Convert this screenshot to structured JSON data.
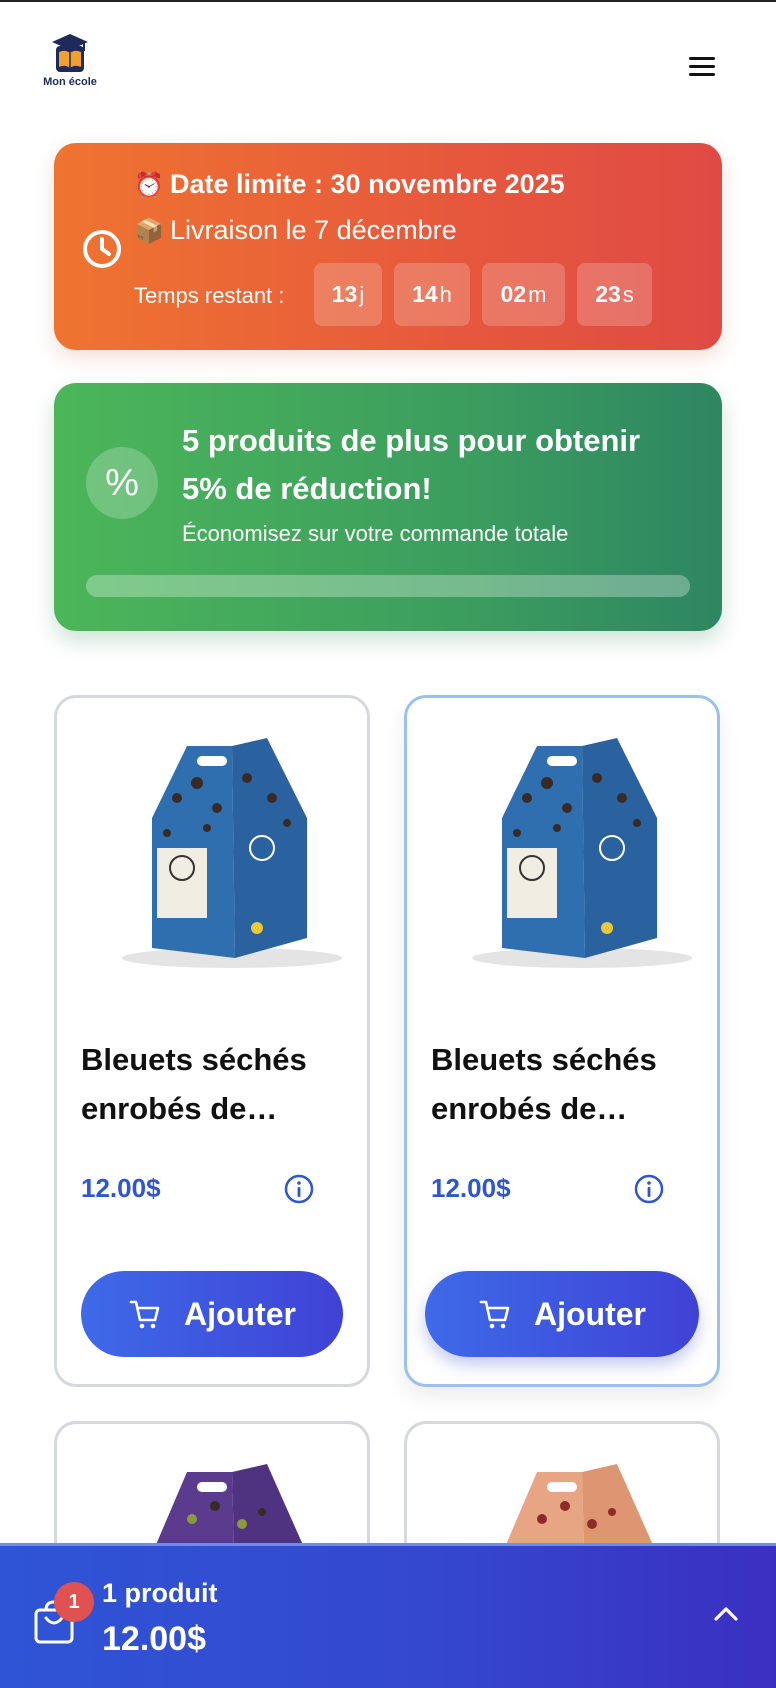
{
  "header": {
    "logo_text": "Mon école",
    "logo_icon": "school-book-icon",
    "menu_icon": "hamburger-menu-icon"
  },
  "deadline": {
    "title_emoji": "⏰",
    "title": "Date limite : 30 novembre 2025",
    "delivery_emoji": "📦",
    "delivery": "Livraison le 7 décembre",
    "remaining_label": "Temps restant :",
    "countdown": [
      {
        "value": "13",
        "unit": "j"
      },
      {
        "value": "14",
        "unit": "h"
      },
      {
        "value": "02",
        "unit": "m"
      },
      {
        "value": "23",
        "unit": "s"
      }
    ],
    "icon": "clock-icon"
  },
  "discount": {
    "symbol": "%",
    "title": "5 produits de plus pour obtenir 5% de réduction!",
    "subtitle": "Économisez sur votre commande totale",
    "progress": 0
  },
  "products": [
    {
      "name": "Bleuets séchés enrobés de…",
      "price": "12.00$",
      "button": "Ajouter",
      "color": "#2f6fb0"
    },
    {
      "name": "Bleuets séchés enrobés de…",
      "price": "12.00$",
      "button": "Ajouter",
      "color": "#2f6fb0"
    }
  ],
  "cart": {
    "badge": "1",
    "count_label": "1 produit",
    "total": "12.00$"
  },
  "colors": {
    "accent": "#2d56d0",
    "deadline_start": "#ef7430",
    "deadline_end": "#e04a44",
    "discount_start": "#4cb65a",
    "discount_end": "#2e8662",
    "cart_bar": "#3448cf",
    "badge": "#e05151"
  }
}
